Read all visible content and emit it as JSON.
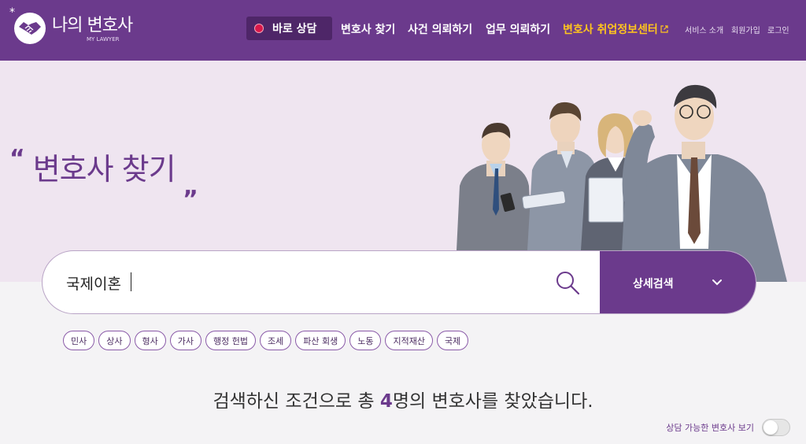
{
  "header": {
    "logo_text": "나의 변호사",
    "logo_sub": "MY LAWYER",
    "logo_star": "*",
    "consult_label": "바로 상담",
    "nav": {
      "find_lawyer": "변호사 찾기",
      "case_request": "사건 의뢰하기",
      "work_request": "업무 의뢰하기",
      "job_center": "변호사 취업정보센터"
    },
    "util": {
      "about": "서비스 소개",
      "signup": "회원가입",
      "login": "로그인"
    }
  },
  "hero": {
    "quote_open": "“",
    "title": "변호사 찾기",
    "quote_close": "„"
  },
  "search": {
    "value": "국제이혼",
    "detail_label": "상세검색"
  },
  "tags": [
    "민사",
    "상사",
    "형사",
    "가사",
    "행정 헌법",
    "조세",
    "파산 회생",
    "노동",
    "지적재산",
    "국제"
  ],
  "result": {
    "prefix": "검색하신 조건으로 총 ",
    "count": "4",
    "suffix": "명의 변호사를 찾았습니다."
  },
  "toggle": {
    "label": "상담 가능한 변호사 보기",
    "on": false
  },
  "colors": {
    "brand": "#6b3a8c",
    "brand_dark": "#4e2668",
    "accent_gold": "#ffc41e",
    "live_dot": "#d9184a",
    "hero_bg": "#efe5f0"
  }
}
